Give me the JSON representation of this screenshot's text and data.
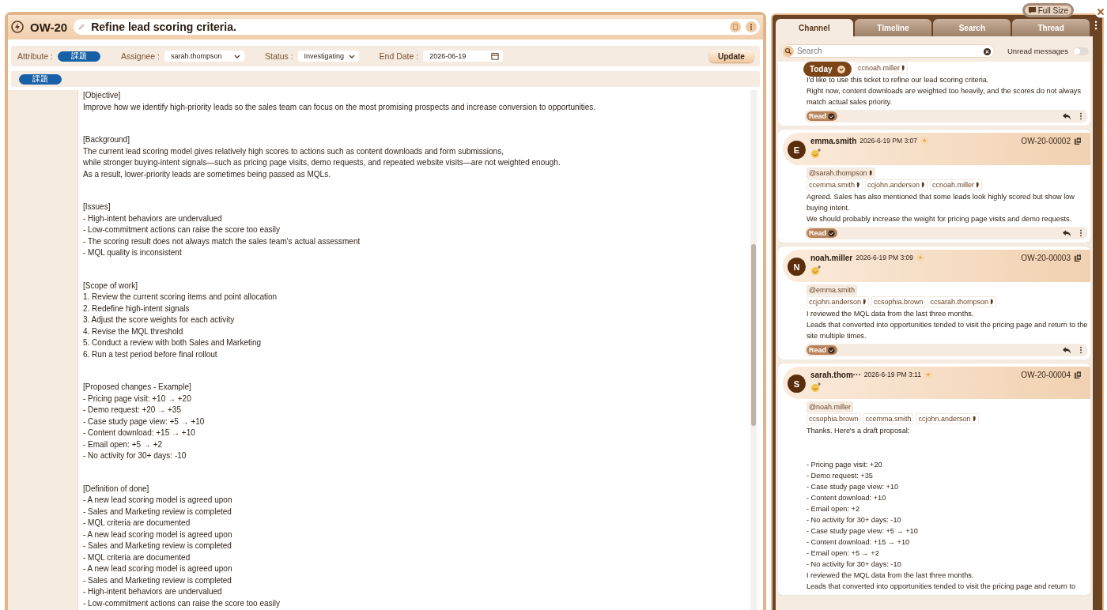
{
  "ticket": {
    "key": "OW-20",
    "title": "Refine lead scoring criteria."
  },
  "filters": {
    "attribute_label": "Attribute :",
    "attribute_tag": "課題",
    "assignee_label": "Assignee :",
    "assignee": "sarah.thompson",
    "status_label": "Status :",
    "status": "Investigating",
    "end_date_label": "End Date :",
    "end_date": "2026-06-19",
    "update_button": "Update"
  },
  "tags": [
    "課題"
  ],
  "description": [
    {
      "lines": [
        "[Objective]",
        "Improve how we identify high-priority leads so the sales team can focus on the most promising prospects and increase conversion to opportunities."
      ]
    },
    {
      "lines": [
        "[Background]",
        "The current lead scoring model gives relatively high scores to actions such as content downloads and form submissions,",
        "while stronger buying-intent signals—such as pricing page visits, demo requests, and repeated website visits—are not weighted enough.",
        "As a result, lower-priority leads are sometimes being passed as MQLs."
      ]
    },
    {
      "lines": [
        "[Issues]",
        "- High-intent behaviors are undervalued",
        "- Low-commitment actions can raise the score too easily",
        "- The scoring result does not always match the sales team's actual assessment",
        "- MQL quality is inconsistent"
      ]
    },
    {
      "lines": [
        "[Scope of work]",
        "1. Review the current scoring items and point allocation",
        "2. Redefine high-intent signals",
        "3. Adjust the score weights for each activity",
        "4. Revise the MQL threshold",
        "5. Conduct a review with both Sales and Marketing",
        "6. Run a test period before final rollout"
      ]
    },
    {
      "lines": [
        "[Proposed changes - Example]",
        "- Pricing page visit: +10 → +20",
        "- Demo request: +20 → +35",
        "- Case study page view: +5 → +10",
        "- Content download: +15 → +10",
        "- Email open: +5 → +2",
        "- No activity for 30+ days: -10"
      ]
    },
    {
      "lines": [
        "[Definition of done]",
        "- A new lead scoring model is agreed upon",
        "- Sales and Marketing review is completed",
        "- MQL criteria are documented",
        "- A new lead scoring model is agreed upon",
        "- Sales and Marketing review is completed",
        "- MQL criteria are documented",
        "- A new lead scoring model is agreed upon",
        "- Sales and Marketing review is completed",
        "- High-intent behaviors are undervalued",
        "- Low-commitment actions can raise the score too easily"
      ]
    }
  ],
  "panel": {
    "full_size": "Full Size",
    "tabs": [
      {
        "label": "Channel",
        "selected": true
      },
      {
        "label": "Timeline",
        "selected": false
      },
      {
        "label": "Search",
        "selected": false
      },
      {
        "label": "Thread",
        "selected": false
      }
    ],
    "search": {
      "placeholder": "Search"
    },
    "unread_label": "Unread messages",
    "unread_on": false,
    "today": "Today",
    "messages": [
      {
        "cc": [
          {
            "text": "ccnoah.miller",
            "seen": true
          }
        ],
        "paragraphs": [
          "I'd like to use this ticket to refine our lead scoring criteria.",
          "Right now, content downloads are weighted too heavily, and the scores do not always match actual sales priority."
        ],
        "read": "Read"
      },
      {
        "avatar": "E",
        "author": "emma.smith",
        "time": "2026-6-19 PM 3:07",
        "ref": "OW-20-00002",
        "mention": {
          "text": "@sarah.thompson",
          "seen": true
        },
        "cc": [
          {
            "text": "ccemma.smith",
            "seen": true
          },
          {
            "text": "ccjohn.anderson",
            "seen": true
          },
          {
            "text": "ccnoah.miller",
            "seen": true
          }
        ],
        "paragraphs": [
          "Agreed. Sales has also mentioned that some leads look highly scored but show low buying intent.",
          "We should probably increase the weight for pricing page visits and demo requests."
        ],
        "read": "Read"
      },
      {
        "avatar": "N",
        "author": "noah.miller",
        "time": "2026-6-19 PM 3:09",
        "ref": "OW-20-00003",
        "mention": {
          "text": "@emma.smith",
          "seen": false
        },
        "cc": [
          {
            "text": "ccjohn.anderson",
            "seen": true
          },
          {
            "text": "ccsophia.brown",
            "seen": false
          },
          {
            "text": "ccsarah.thompson",
            "seen": true
          }
        ],
        "paragraphs": [
          "I reviewed the MQL data from the last three months.",
          "Leads that converted into opportunities tended to visit the pricing page and return to the site multiple times."
        ],
        "read": "Read"
      },
      {
        "avatar": "S",
        "author": "sarah.thom···",
        "time": "2026-6-19 PM 3:11",
        "ref": "OW-20-00004",
        "mention": {
          "text": "@noah.miller",
          "seen": false
        },
        "cc": [
          {
            "text": "ccsophia.brown",
            "seen": false
          },
          {
            "text": "ccemma.smith",
            "seen": false
          },
          {
            "text": "ccjohn.anderson",
            "seen": true
          }
        ],
        "paragraphs": [
          "Thanks. Here's a draft proposal:"
        ],
        "list": [
          "- Pricing page visit: +20",
          "- Demo request: +35",
          "- Case study page view: +10",
          "- Content download: +10",
          "- Email open: +2",
          "- No activity for 30+ days: -10",
          "- Case study page view: +5 → +10",
          "- Content download: +15 → +10",
          "- Email open: +5 → +2",
          "- No activity for 30+ days: -10"
        ],
        "tail": [
          "I reviewed the MQL data from the last three months.",
          "Leads that converted into opportunities tended to visit the pricing page and return to"
        ]
      }
    ]
  }
}
